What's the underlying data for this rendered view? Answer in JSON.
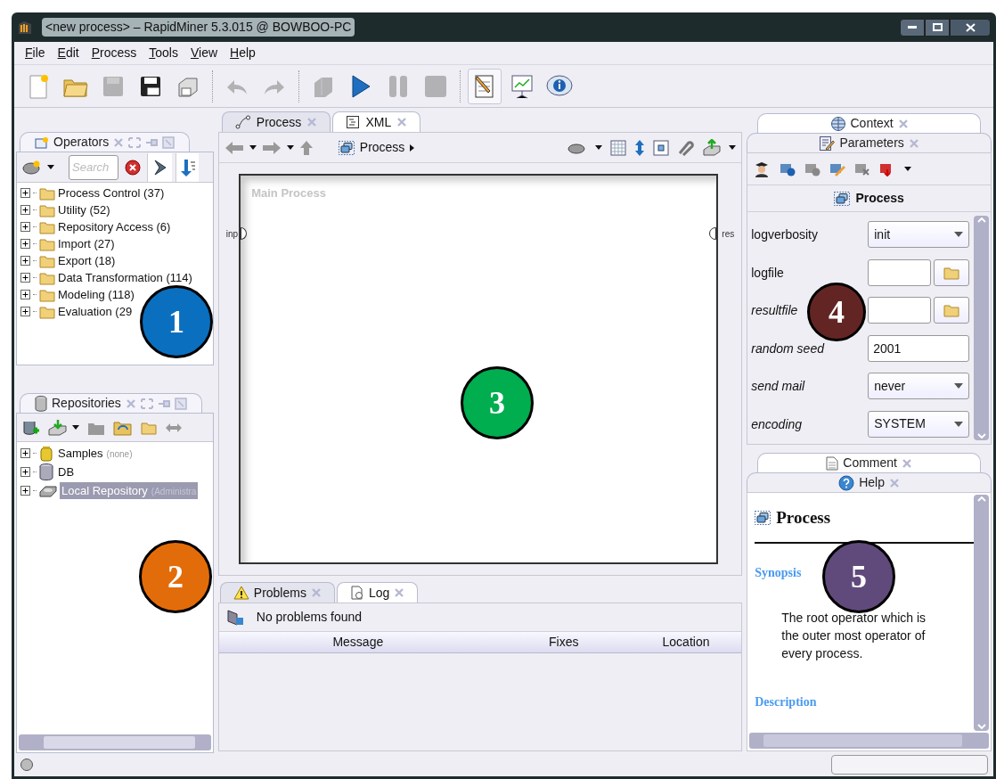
{
  "window": {
    "title": "<new process> – RapidMiner 5.3.015 @ BOWBOO-PC"
  },
  "menu": [
    "File",
    "Edit",
    "Process",
    "Tools",
    "View",
    "Help"
  ],
  "toolbar": {
    "file_group": [
      {
        "kind": "new",
        "disabled": false
      },
      {
        "kind": "open",
        "disabled": false
      },
      {
        "kind": "save",
        "disabled": true
      },
      {
        "kind": "save_as",
        "disabled": false
      },
      {
        "kind": "print",
        "disabled": false
      }
    ],
    "edit_group": [
      {
        "kind": "undo",
        "disabled": true
      },
      {
        "kind": "redo",
        "disabled": true
      }
    ],
    "run_group": [
      {
        "kind": "block",
        "disabled": true
      },
      {
        "kind": "run",
        "disabled": false
      },
      {
        "kind": "pause",
        "disabled": true
      },
      {
        "kind": "stop",
        "disabled": true
      }
    ],
    "perspectives": [
      {
        "kind": "design",
        "selected": true
      },
      {
        "kind": "results",
        "selected": false
      },
      {
        "kind": "about",
        "selected": false
      }
    ]
  },
  "operators": {
    "title": "Operators",
    "search_placeholder": "Search",
    "tree": [
      {
        "label": "Process Control (37)",
        "expanded": false
      },
      {
        "label": "Utility (52)",
        "expanded": false
      },
      {
        "label": "Repository Access (6)",
        "expanded": false
      },
      {
        "label": "Import (27)",
        "expanded": false
      },
      {
        "label": "Export (18)",
        "expanded": false
      },
      {
        "label": "Data Transformation (114)",
        "expanded": false
      },
      {
        "label": "Modeling (118)",
        "expanded": false
      },
      {
        "label": "Evaluation (29",
        "expanded": false
      }
    ]
  },
  "repositories": {
    "title": "Repositories",
    "items": [
      {
        "kind": "samples",
        "label": "Samples",
        "note": "(none)",
        "selected": false,
        "expanded": false
      },
      {
        "kind": "database",
        "label": "DB",
        "selected": false,
        "expanded": false
      },
      {
        "kind": "local",
        "label": "Local Repository",
        "note": "(Administra",
        "selected": true,
        "expanded": false
      }
    ]
  },
  "process_tabs": [
    {
      "kind": "process",
      "label": "Process",
      "selected": true
    },
    {
      "kind": "xml",
      "label": "XML",
      "selected": false
    }
  ],
  "process_view": {
    "breadcrumb": "Process",
    "canvas_title": "Main Process",
    "input_port": "inp",
    "output_port": "res"
  },
  "bottom_tabs": [
    {
      "kind": "problems",
      "label": "Problems",
      "selected": true
    },
    {
      "kind": "log",
      "label": "Log",
      "selected": false
    }
  ],
  "problems": {
    "status": "No problems found",
    "columns": [
      "Message",
      "Fixes",
      "Location"
    ]
  },
  "right_tabs": [
    {
      "kind": "context",
      "label": "Context",
      "selected": false
    },
    {
      "kind": "parameters",
      "label": "Parameters",
      "selected": true
    }
  ],
  "parameters": {
    "operator": "Process",
    "rows": [
      {
        "label": "logverbosity",
        "expert": false,
        "kind": "select",
        "value": "init"
      },
      {
        "label": "logfile",
        "expert": false,
        "kind": "file"
      },
      {
        "label": "resultfile",
        "expert": true,
        "kind": "file"
      },
      {
        "label": "random seed",
        "expert": true,
        "kind": "text",
        "value": "2001"
      },
      {
        "label": "send mail",
        "expert": true,
        "kind": "select",
        "value": "never"
      },
      {
        "label": "encoding",
        "expert": true,
        "kind": "select",
        "value": "SYSTEM"
      }
    ]
  },
  "help_tabs": [
    {
      "kind": "comment",
      "label": "Comment",
      "selected": false
    },
    {
      "kind": "help",
      "label": "Help",
      "selected": true
    }
  ],
  "help": {
    "title": "Process",
    "synopsis_heading": "Synopsis",
    "synopsis": "The root operator which is the outer most operator of every process.",
    "description_heading": "Description"
  },
  "callouts": [
    {
      "label": "1",
      "color": "#0b6fbf"
    },
    {
      "label": "2",
      "color": "#e36c0a"
    },
    {
      "label": "3",
      "color": "#00ad4f"
    },
    {
      "label": "4",
      "color": "#632523"
    },
    {
      "label": "5",
      "color": "#604a7b"
    }
  ]
}
